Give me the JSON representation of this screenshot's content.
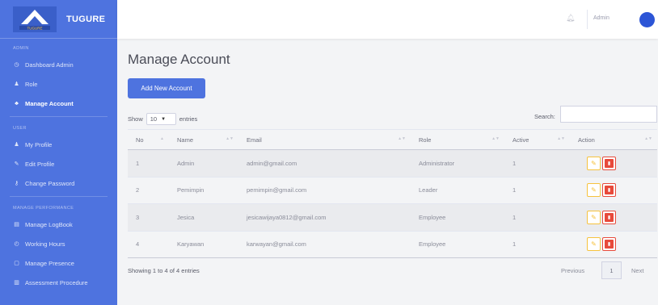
{
  "brand": {
    "name": "TUGURE",
    "logo_text": "TUGURE"
  },
  "sidebar": {
    "sections": [
      {
        "heading": "ADMIN",
        "items": [
          {
            "label": "Dashboard Admin",
            "icon": "dashboard-icon"
          },
          {
            "label": "Role",
            "icon": "user-icon"
          },
          {
            "label": "Manage Account",
            "icon": "users-icon",
            "active": true
          }
        ]
      },
      {
        "heading": "USER",
        "items": [
          {
            "label": "My Profile",
            "icon": "user-icon"
          },
          {
            "label": "Edit Profile",
            "icon": "user-edit-icon"
          },
          {
            "label": "Change Password",
            "icon": "key-icon"
          }
        ]
      },
      {
        "heading": "MANAGE PERFORMANCE",
        "items": [
          {
            "label": "Manage LogBook",
            "icon": "book-icon"
          },
          {
            "label": "Working Hours",
            "icon": "clock-icon"
          },
          {
            "label": "Manage Presence",
            "icon": "calendar-icon"
          },
          {
            "label": "Assessment Procedure",
            "icon": "chart-icon"
          }
        ]
      }
    ]
  },
  "topbar": {
    "user_name": "Admin"
  },
  "main": {
    "title": "Manage Account",
    "add_button": "Add New Account",
    "show_label": "Show",
    "show_value": "10",
    "entries_label": "entries",
    "search_label": "Search:",
    "columns": [
      "No",
      "Name",
      "Email",
      "Role",
      "Active",
      "Action"
    ],
    "rows": [
      {
        "no": "1",
        "name": "Admin",
        "email": "admin@gmail.com",
        "role": "Administrator",
        "active": "1"
      },
      {
        "no": "2",
        "name": "Pemimpin",
        "email": "pemimpin@gmail.com",
        "role": "Leader",
        "active": "1"
      },
      {
        "no": "3",
        "name": "Jesica",
        "email": "jesicawijaya0812@gmail.com",
        "role": "Employee",
        "active": "1"
      },
      {
        "no": "4",
        "name": "Karyawan",
        "email": "karwayan@gmail.com",
        "role": "Employee",
        "active": "1"
      }
    ],
    "info": "Showing 1 to 4 of 4 entries",
    "pagination": {
      "previous": "Previous",
      "page": "1",
      "next": "Next"
    }
  },
  "colors": {
    "primary": "#4e73df",
    "edit": "#f6c23e",
    "delete": "#e74a3b"
  }
}
